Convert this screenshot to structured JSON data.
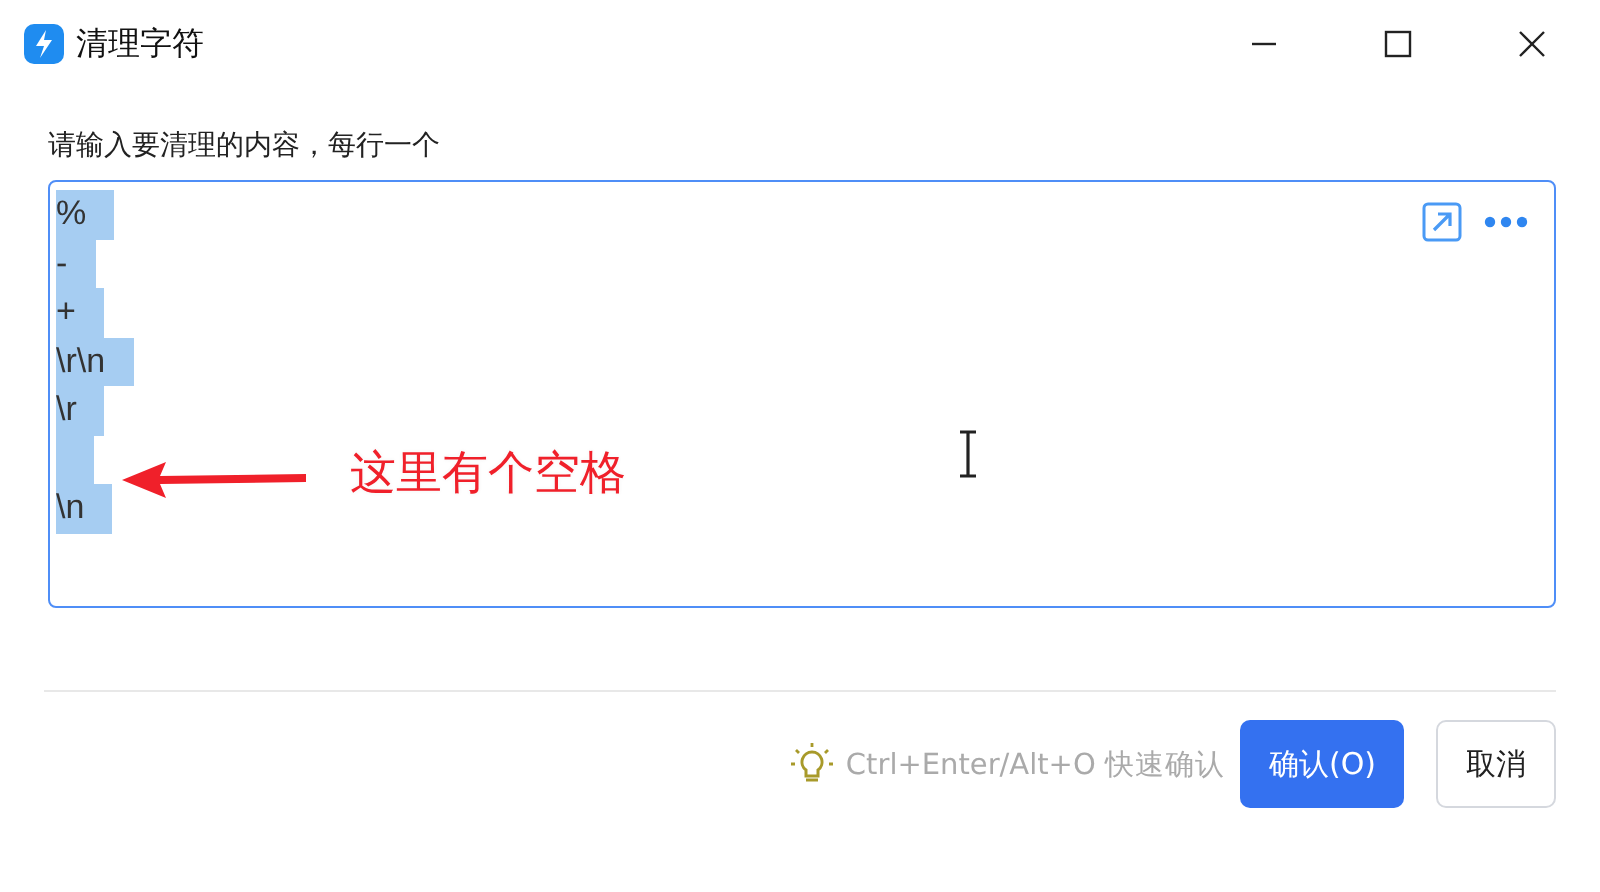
{
  "window": {
    "title": "清理字符"
  },
  "prompt": "请输入要清理的内容，每行一个",
  "editor": {
    "lines": [
      {
        "text": "%",
        "selected": true
      },
      {
        "text": "-",
        "selected": true
      },
      {
        "text": "+",
        "selected": true
      },
      {
        "text": "\\r\\n",
        "selected": true
      },
      {
        "text": "\\r",
        "selected": true
      },
      {
        "selected": true
      },
      {
        "text": "\\n",
        "selected": true
      }
    ]
  },
  "annotation": {
    "text": "这里有个空格"
  },
  "footer": {
    "hint": "Ctrl+Enter/Alt+O 快速确认",
    "buttons": [
      {
        "label": "确认(O)",
        "kind": "primary"
      },
      {
        "label": "取消",
        "kind": "secondary"
      }
    ]
  }
}
